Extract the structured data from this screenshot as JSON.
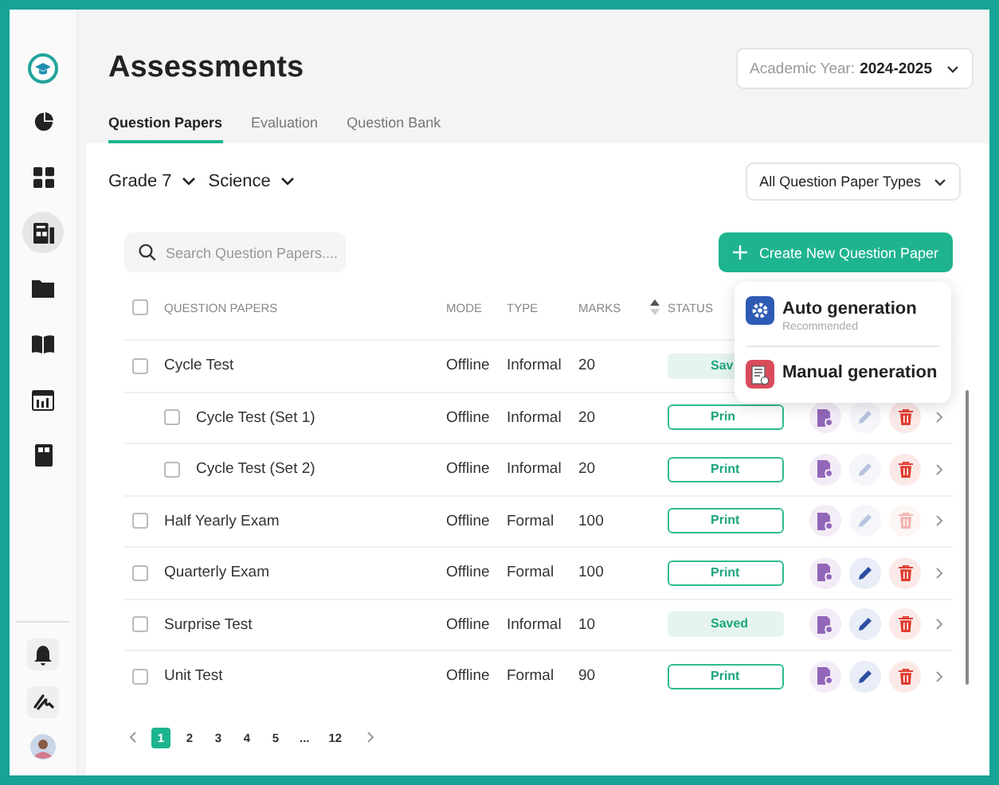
{
  "sidebar": {
    "items": [
      {
        "kind": "chart",
        "selected": false
      },
      {
        "kind": "grid",
        "selected": false
      },
      {
        "kind": "papers",
        "selected": true
      },
      {
        "kind": "folder",
        "selected": false
      },
      {
        "kind": "book",
        "selected": false
      },
      {
        "kind": "calendar",
        "selected": false
      },
      {
        "kind": "document",
        "selected": false
      }
    ],
    "bottom": [
      {
        "kind": "bell"
      },
      {
        "kind": "signature"
      },
      {
        "kind": "avatar"
      }
    ]
  },
  "header": {
    "title": "Assessments",
    "academic_year": {
      "label": "Academic Year:",
      "value": "2024-2025"
    }
  },
  "tabs": [
    {
      "label": "Question Papers",
      "selected": true
    },
    {
      "label": "Evaluation",
      "selected": false
    },
    {
      "label": "Question Bank",
      "selected": false
    }
  ],
  "filters": {
    "grade": "Grade 7",
    "subject": "Science",
    "paper_type": "All Question Paper Types"
  },
  "search": {
    "placeholder": "Search Question Papers...."
  },
  "create_button": {
    "label": "Create New Question Paper"
  },
  "create_menu": [
    {
      "kind": "auto",
      "label": "Auto generation",
      "note": "Recommended"
    },
    {
      "kind": "manual",
      "label": "Manual generation"
    }
  ],
  "table": {
    "all_checked": false,
    "columns": [
      "QUESTION PAPERS",
      "MODE",
      "TYPE",
      "MARKS",
      "STATUS"
    ],
    "rows": [
      {
        "name": "Cycle Test",
        "mode": "Offline",
        "type": "Informal",
        "marks": "20",
        "status": {
          "kind": "saved",
          "text": "Sav"
        },
        "checked": false,
        "children": [
          {
            "name": "Cycle Test (Set 1)",
            "mode": "Offline",
            "type": "Informal",
            "marks": "20",
            "status": {
              "kind": "print",
              "text": "Prin"
            },
            "checked": false,
            "actions": {
              "edit": false,
              "delete": true
            }
          },
          {
            "name": "Cycle Test (Set 2)",
            "mode": "Offline",
            "type": "Informal",
            "marks": "20",
            "status": {
              "kind": "print",
              "text": "Print"
            },
            "checked": false,
            "actions": {
              "edit": false,
              "delete": true
            }
          }
        ]
      },
      {
        "name": "Half Yearly Exam",
        "mode": "Offline",
        "type": "Formal",
        "marks": "100",
        "status": {
          "kind": "print",
          "text": "Print"
        },
        "checked": false,
        "actions": {
          "edit": false,
          "delete": false
        }
      },
      {
        "name": "Quarterly Exam",
        "mode": "Offline",
        "type": "Formal",
        "marks": "100",
        "status": {
          "kind": "print",
          "text": "Print"
        },
        "checked": false,
        "actions": {
          "edit": true,
          "delete": true
        }
      },
      {
        "name": "Surprise Test",
        "mode": "Offline",
        "type": "Informal",
        "marks": "10",
        "status": {
          "kind": "saved",
          "text": "Saved"
        },
        "checked": false,
        "actions": {
          "edit": true,
          "delete": true
        }
      },
      {
        "name": "Unit Test",
        "mode": "Offline",
        "type": "Formal",
        "marks": "90",
        "status": {
          "kind": "print",
          "text": "Print"
        },
        "checked": false,
        "actions": {
          "edit": true,
          "delete": true
        }
      }
    ]
  },
  "pagination": {
    "pages": [
      {
        "label": "1",
        "selected": true
      },
      {
        "label": "2",
        "selected": false
      },
      {
        "label": "3",
        "selected": false
      },
      {
        "label": "4",
        "selected": false
      },
      {
        "label": "5",
        "selected": false
      },
      {
        "label": "...",
        "selected": false
      },
      {
        "label": "12",
        "selected": false
      }
    ]
  }
}
